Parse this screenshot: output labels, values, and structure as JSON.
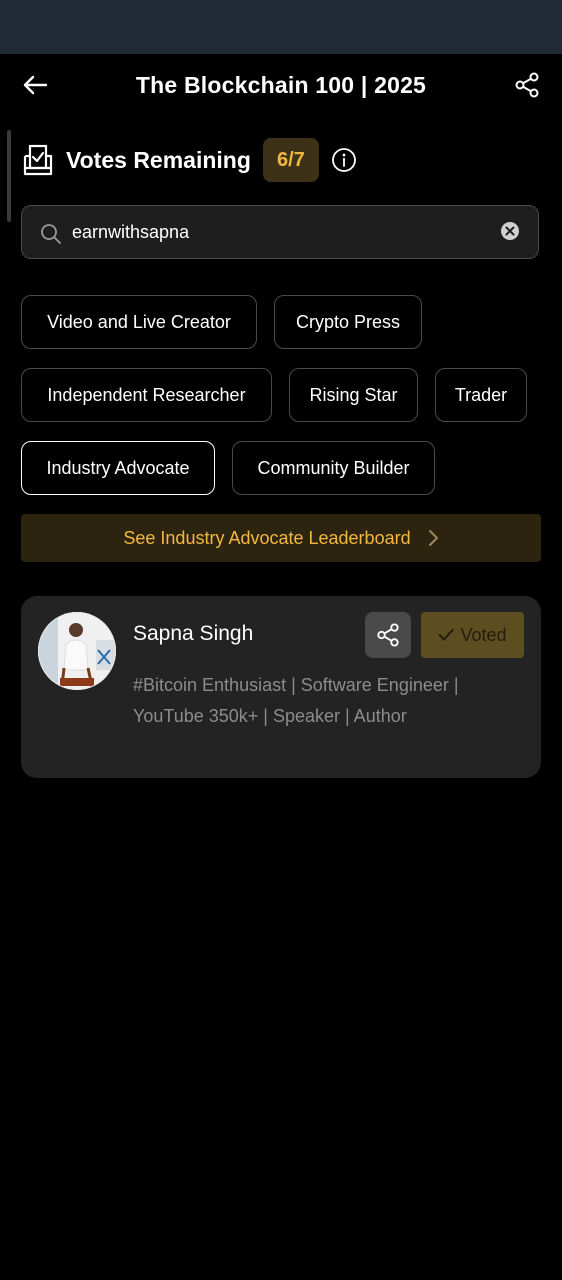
{
  "header": {
    "title": "The Blockchain 100 | 2025"
  },
  "votes": {
    "label": "Votes Remaining",
    "count": "6/7"
  },
  "search": {
    "value": "earnwithsapna"
  },
  "categories": [
    "Video and Live Creator",
    "Crypto Press",
    "Independent Researcher",
    "Rising Star",
    "Trader",
    "Industry Advocate",
    "Community Builder"
  ],
  "selected_category": "Industry Advocate",
  "leaderboard": {
    "label": "See Industry Advocate Leaderboard"
  },
  "result": {
    "name": "Sapna Singh",
    "voted_label": "Voted",
    "bio": "#Bitcoin Enthusiast | Software Engineer | YouTube 350k+ | Speaker | Author"
  },
  "colors": {
    "accent": "#f2b73f",
    "background": "#000000",
    "card": "#232323",
    "status_bar": "#222a35"
  }
}
